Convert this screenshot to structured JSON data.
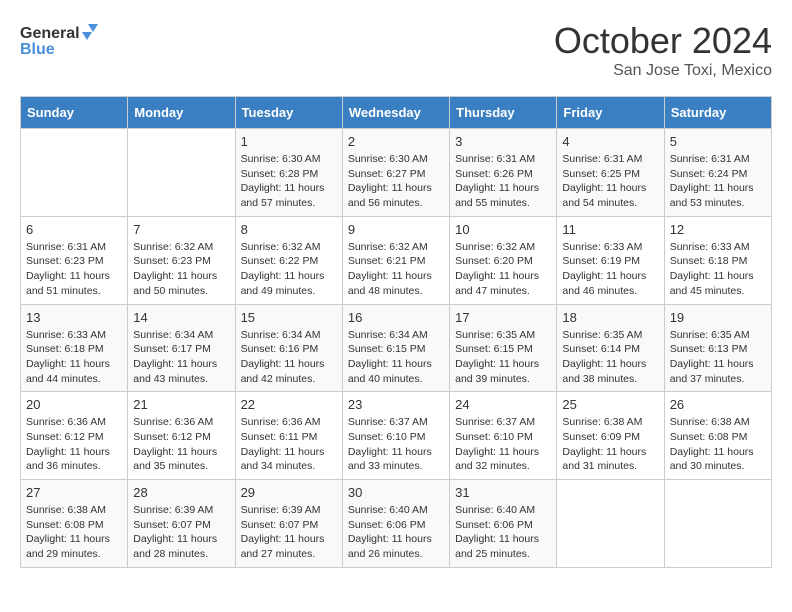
{
  "header": {
    "logo_general": "General",
    "logo_blue": "Blue",
    "month": "October 2024",
    "location": "San Jose Toxi, Mexico"
  },
  "days_of_week": [
    "Sunday",
    "Monday",
    "Tuesday",
    "Wednesday",
    "Thursday",
    "Friday",
    "Saturday"
  ],
  "weeks": [
    [
      {
        "day": "",
        "sunrise": "",
        "sunset": "",
        "daylight": ""
      },
      {
        "day": "",
        "sunrise": "",
        "sunset": "",
        "daylight": ""
      },
      {
        "day": "1",
        "sunrise": "Sunrise: 6:30 AM",
        "sunset": "Sunset: 6:28 PM",
        "daylight": "Daylight: 11 hours and 57 minutes."
      },
      {
        "day": "2",
        "sunrise": "Sunrise: 6:30 AM",
        "sunset": "Sunset: 6:27 PM",
        "daylight": "Daylight: 11 hours and 56 minutes."
      },
      {
        "day": "3",
        "sunrise": "Sunrise: 6:31 AM",
        "sunset": "Sunset: 6:26 PM",
        "daylight": "Daylight: 11 hours and 55 minutes."
      },
      {
        "day": "4",
        "sunrise": "Sunrise: 6:31 AM",
        "sunset": "Sunset: 6:25 PM",
        "daylight": "Daylight: 11 hours and 54 minutes."
      },
      {
        "day": "5",
        "sunrise": "Sunrise: 6:31 AM",
        "sunset": "Sunset: 6:24 PM",
        "daylight": "Daylight: 11 hours and 53 minutes."
      }
    ],
    [
      {
        "day": "6",
        "sunrise": "Sunrise: 6:31 AM",
        "sunset": "Sunset: 6:23 PM",
        "daylight": "Daylight: 11 hours and 51 minutes."
      },
      {
        "day": "7",
        "sunrise": "Sunrise: 6:32 AM",
        "sunset": "Sunset: 6:23 PM",
        "daylight": "Daylight: 11 hours and 50 minutes."
      },
      {
        "day": "8",
        "sunrise": "Sunrise: 6:32 AM",
        "sunset": "Sunset: 6:22 PM",
        "daylight": "Daylight: 11 hours and 49 minutes."
      },
      {
        "day": "9",
        "sunrise": "Sunrise: 6:32 AM",
        "sunset": "Sunset: 6:21 PM",
        "daylight": "Daylight: 11 hours and 48 minutes."
      },
      {
        "day": "10",
        "sunrise": "Sunrise: 6:32 AM",
        "sunset": "Sunset: 6:20 PM",
        "daylight": "Daylight: 11 hours and 47 minutes."
      },
      {
        "day": "11",
        "sunrise": "Sunrise: 6:33 AM",
        "sunset": "Sunset: 6:19 PM",
        "daylight": "Daylight: 11 hours and 46 minutes."
      },
      {
        "day": "12",
        "sunrise": "Sunrise: 6:33 AM",
        "sunset": "Sunset: 6:18 PM",
        "daylight": "Daylight: 11 hours and 45 minutes."
      }
    ],
    [
      {
        "day": "13",
        "sunrise": "Sunrise: 6:33 AM",
        "sunset": "Sunset: 6:18 PM",
        "daylight": "Daylight: 11 hours and 44 minutes."
      },
      {
        "day": "14",
        "sunrise": "Sunrise: 6:34 AM",
        "sunset": "Sunset: 6:17 PM",
        "daylight": "Daylight: 11 hours and 43 minutes."
      },
      {
        "day": "15",
        "sunrise": "Sunrise: 6:34 AM",
        "sunset": "Sunset: 6:16 PM",
        "daylight": "Daylight: 11 hours and 42 minutes."
      },
      {
        "day": "16",
        "sunrise": "Sunrise: 6:34 AM",
        "sunset": "Sunset: 6:15 PM",
        "daylight": "Daylight: 11 hours and 40 minutes."
      },
      {
        "day": "17",
        "sunrise": "Sunrise: 6:35 AM",
        "sunset": "Sunset: 6:15 PM",
        "daylight": "Daylight: 11 hours and 39 minutes."
      },
      {
        "day": "18",
        "sunrise": "Sunrise: 6:35 AM",
        "sunset": "Sunset: 6:14 PM",
        "daylight": "Daylight: 11 hours and 38 minutes."
      },
      {
        "day": "19",
        "sunrise": "Sunrise: 6:35 AM",
        "sunset": "Sunset: 6:13 PM",
        "daylight": "Daylight: 11 hours and 37 minutes."
      }
    ],
    [
      {
        "day": "20",
        "sunrise": "Sunrise: 6:36 AM",
        "sunset": "Sunset: 6:12 PM",
        "daylight": "Daylight: 11 hours and 36 minutes."
      },
      {
        "day": "21",
        "sunrise": "Sunrise: 6:36 AM",
        "sunset": "Sunset: 6:12 PM",
        "daylight": "Daylight: 11 hours and 35 minutes."
      },
      {
        "day": "22",
        "sunrise": "Sunrise: 6:36 AM",
        "sunset": "Sunset: 6:11 PM",
        "daylight": "Daylight: 11 hours and 34 minutes."
      },
      {
        "day": "23",
        "sunrise": "Sunrise: 6:37 AM",
        "sunset": "Sunset: 6:10 PM",
        "daylight": "Daylight: 11 hours and 33 minutes."
      },
      {
        "day": "24",
        "sunrise": "Sunrise: 6:37 AM",
        "sunset": "Sunset: 6:10 PM",
        "daylight": "Daylight: 11 hours and 32 minutes."
      },
      {
        "day": "25",
        "sunrise": "Sunrise: 6:38 AM",
        "sunset": "Sunset: 6:09 PM",
        "daylight": "Daylight: 11 hours and 31 minutes."
      },
      {
        "day": "26",
        "sunrise": "Sunrise: 6:38 AM",
        "sunset": "Sunset: 6:08 PM",
        "daylight": "Daylight: 11 hours and 30 minutes."
      }
    ],
    [
      {
        "day": "27",
        "sunrise": "Sunrise: 6:38 AM",
        "sunset": "Sunset: 6:08 PM",
        "daylight": "Daylight: 11 hours and 29 minutes."
      },
      {
        "day": "28",
        "sunrise": "Sunrise: 6:39 AM",
        "sunset": "Sunset: 6:07 PM",
        "daylight": "Daylight: 11 hours and 28 minutes."
      },
      {
        "day": "29",
        "sunrise": "Sunrise: 6:39 AM",
        "sunset": "Sunset: 6:07 PM",
        "daylight": "Daylight: 11 hours and 27 minutes."
      },
      {
        "day": "30",
        "sunrise": "Sunrise: 6:40 AM",
        "sunset": "Sunset: 6:06 PM",
        "daylight": "Daylight: 11 hours and 26 minutes."
      },
      {
        "day": "31",
        "sunrise": "Sunrise: 6:40 AM",
        "sunset": "Sunset: 6:06 PM",
        "daylight": "Daylight: 11 hours and 25 minutes."
      },
      {
        "day": "",
        "sunrise": "",
        "sunset": "",
        "daylight": ""
      },
      {
        "day": "",
        "sunrise": "",
        "sunset": "",
        "daylight": ""
      }
    ]
  ]
}
